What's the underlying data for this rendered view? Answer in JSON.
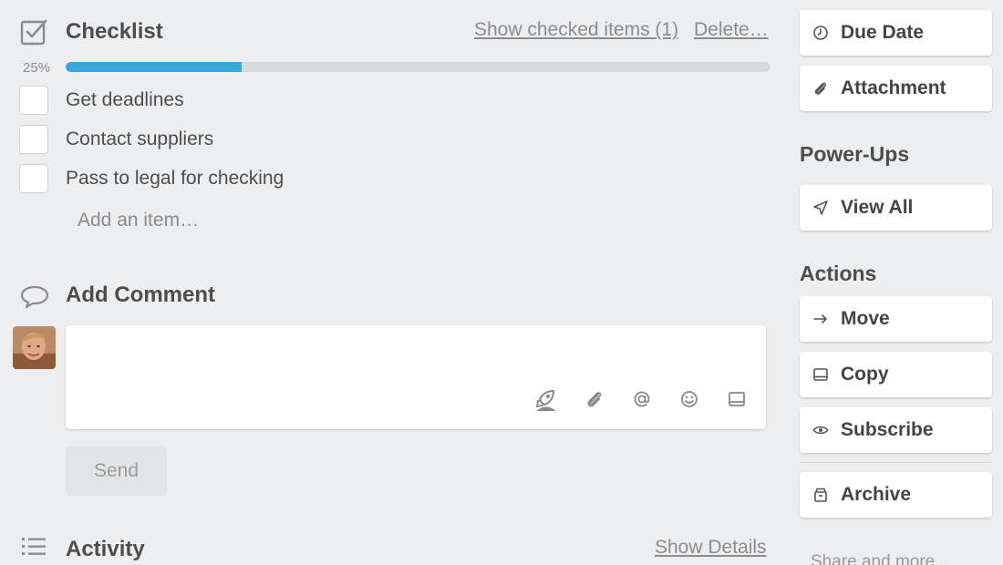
{
  "checklist": {
    "title": "Checklist",
    "show_checked_label": "Show checked items (1)",
    "delete_label": "Delete…",
    "progress_label": "25%",
    "progress_fraction": 0.25,
    "items": [
      {
        "label": "Get deadlines",
        "checked": false
      },
      {
        "label": "Contact suppliers",
        "checked": false
      },
      {
        "label": "Pass to legal for checking",
        "checked": false
      }
    ],
    "add_item_label": "Add an item…"
  },
  "comment": {
    "title": "Add Comment",
    "input_value": "",
    "send_label": "Send",
    "tools": [
      "rocket-icon",
      "attachment-icon",
      "mention-icon",
      "emoji-icon",
      "card-icon"
    ]
  },
  "activity": {
    "title": "Activity",
    "show_details_label": "Show Details"
  },
  "sidebar": {
    "due_date": "Due Date",
    "attachment": "Attachment",
    "powerups_heading": "Power-Ups",
    "view_all": "View All",
    "actions_heading": "Actions",
    "move": "Move",
    "copy": "Copy",
    "subscribe": "Subscribe",
    "archive": "Archive",
    "share_more": "Share and more..."
  },
  "colors": {
    "progress_fill": "#3aa5da",
    "background": "#edeef0"
  }
}
